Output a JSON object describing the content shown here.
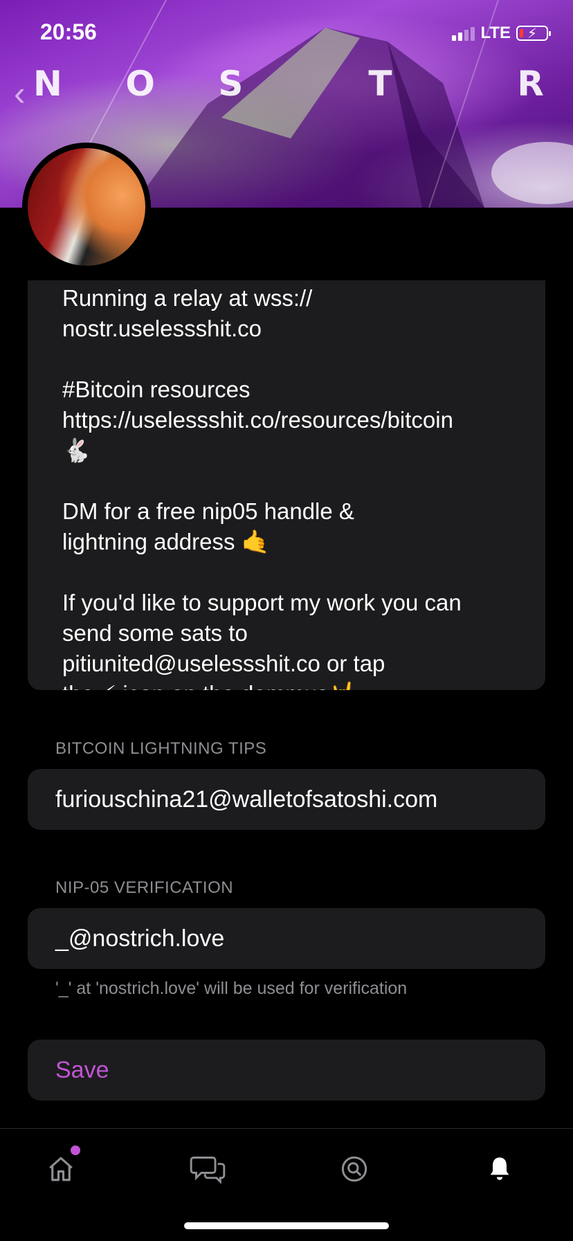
{
  "status_bar": {
    "time": "20:56",
    "network": "LTE"
  },
  "banner": {
    "letters": [
      "N",
      "O",
      "S",
      "",
      "T",
      "",
      "R"
    ]
  },
  "bio": {
    "text": "Running a relay at wss://\nnostr.uselessshit.co\n\n#Bitcoin resources\nhttps://uselessshit.co/resources/bitcoin\n🐇\n\nDM for a free nip05 handle &\nlightning address 🤙\n\nIf you'd like to support my work you can\nsend some sats to\npitiunited@uselessshit.co or tap\nthe ⚡ icon on the dammus🤘"
  },
  "lightning": {
    "label": "BITCOIN LIGHTNING TIPS",
    "value": "furiouschina21@walletofsatoshi.com"
  },
  "nip05": {
    "label": "NIP-05 VERIFICATION",
    "value": "_@nostrich.love",
    "hint": "'_' at 'nostrich.love' will be used for verification"
  },
  "actions": {
    "save_label": "Save"
  },
  "tabs": [
    {
      "name": "home",
      "icon": "home-icon"
    },
    {
      "name": "dms",
      "icon": "chat-bubbles-icon"
    },
    {
      "name": "search",
      "icon": "search-icon"
    },
    {
      "name": "notifications",
      "icon": "bell-icon"
    }
  ],
  "colors": {
    "accent": "#c254d6",
    "card_bg": "#1c1c1e",
    "muted_text": "#8e8e93"
  }
}
